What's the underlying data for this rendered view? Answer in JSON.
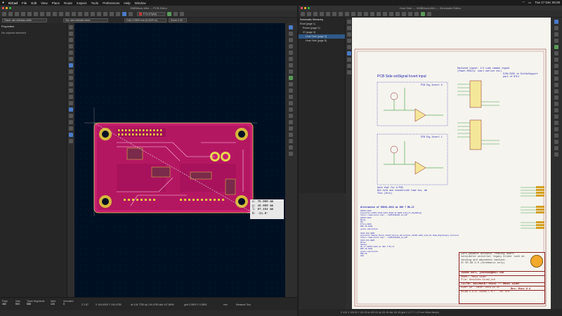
{
  "menubar": {
    "app": "KiCad",
    "items": [
      "File",
      "Edit",
      "View",
      "Place",
      "Route",
      "Inspect",
      "Tools",
      "Preferences",
      "Help",
      "Window"
    ],
    "clock": "Tue 17 Dec 08:28"
  },
  "pcb": {
    "title": "XMBMock-Mini — PCB Editor",
    "track_select": "Track: use netclass width",
    "via_select": "Via: use netclass sizes",
    "grid_select": "Grid: 0.0500 mm (0.0020 in)",
    "zoom_select": "Zoom 2.39",
    "layer_select": "F.Cu (PgUp)",
    "props_title": "Properties",
    "props_text": "No objects selected",
    "readout": {
      "x": "x: 75.000 mm",
      "y": "y: 45.000 mm",
      "l": "l: 87.464 mm",
      "a": "θ: -31.0°"
    },
    "status": {
      "pads_l": "Pads",
      "pads_v": "482",
      "vias_l": "Vias",
      "vias_v": "503",
      "tracks_l": "Track Segments",
      "tracks_v": "688",
      "nets_l": "Nets",
      "nets_v": "124",
      "unrouted_l": "Unrouted",
      "unrouted_v": "0",
      "z": "Z 2.87",
      "xy": "X 104.0000  Y 104.4750",
      "dxy": "dx 104.7750  dy 104.4750  dist 147.6509",
      "grid": "grid 0.0500  Y 0.0500",
      "unit": "mm",
      "mode": "Measure Tool"
    }
  },
  "sch": {
    "title": "Host Side — XMBMock-Mini — Schematic Editor",
    "hier_title": "Schematic Hierarchy",
    "hier": [
      "Root (page 1)",
      "Power (page 2)",
      "IO (page 3)",
      "Host Side (page 4)",
      "Host Side (page 5)"
    ],
    "heading": "PCB Side extSignal Invert input",
    "note1": "Emulated signal: 1/2 side common signal\n(Power-fOOCrp: start earlier etc)",
    "note2": "SJ01/SJ02 in ExtVinSupport\npart of BTC4",
    "block1": "PCB Sig Invert 0",
    "block2": "PCB Sig Invert 1",
    "alt_title": "Alternative of 03515-1013 at 300 T MX-LI",
    "alt_text": "03515-1013\nConnector,2x5PV.4X24,X2X4,3X4H-1X-4E05-1x13_F1,HighRange\nhttps://www.molex.com/.../0351510103_sd.pdf\n03515-1013\nMolex\nMfr\nP/N:m-1013\nDSP-15-1030\ngreen-substitute\n\nX2X4-1X4-4E05\nConnector_Samtec_Molex_X2X13_Series_Horizontal_X2X05-1300_1x13_P1.25mm_RightAngle_Vertical\nhttps://www.molex.com/.../0351510103_sd.pdf\nX2X4-1X4-4E05\nMolex\nSamtec\n05 of 03515-1013 at 300 T MX-LI\nDSP-15-1030\ngreen-substitute\nASP-15\nLED",
    "note_small": "Note that for X-PCB:\nBut hold and counterside load too, mm\nThis (this)",
    "desc": "Card payment acceptor reading board\nconsidered universal legacy broker such as\nvending and amusement machine.\nCC BY-SA 3.0 (Schematic only)",
    "author": "Joonas Kort, joonska@gmail.com",
    "sheet_line": "Sheet: /Host Side/",
    "file_line": "File: HostSide.kicad_sch",
    "tb_title": "Title: ExtMock--Mini -- Host Side",
    "tb_size": "Size: A4",
    "tb_date": "Date: 2023-12-31",
    "tb_rev": "Rev: Mini 0.4",
    "tb_kicad": "KiCad E.D.A.  kicad 7.0.7",
    "tb_id": "Id: 4/5",
    "pcb_inverter_label": "PCB Sig Invert",
    "status": "Z 4.51   X 100.00  Y 101.00   dx 000.00  dy 101.00  dist 141.53   grid X 1.27  Y 1.27   mm   Select item(s)"
  }
}
